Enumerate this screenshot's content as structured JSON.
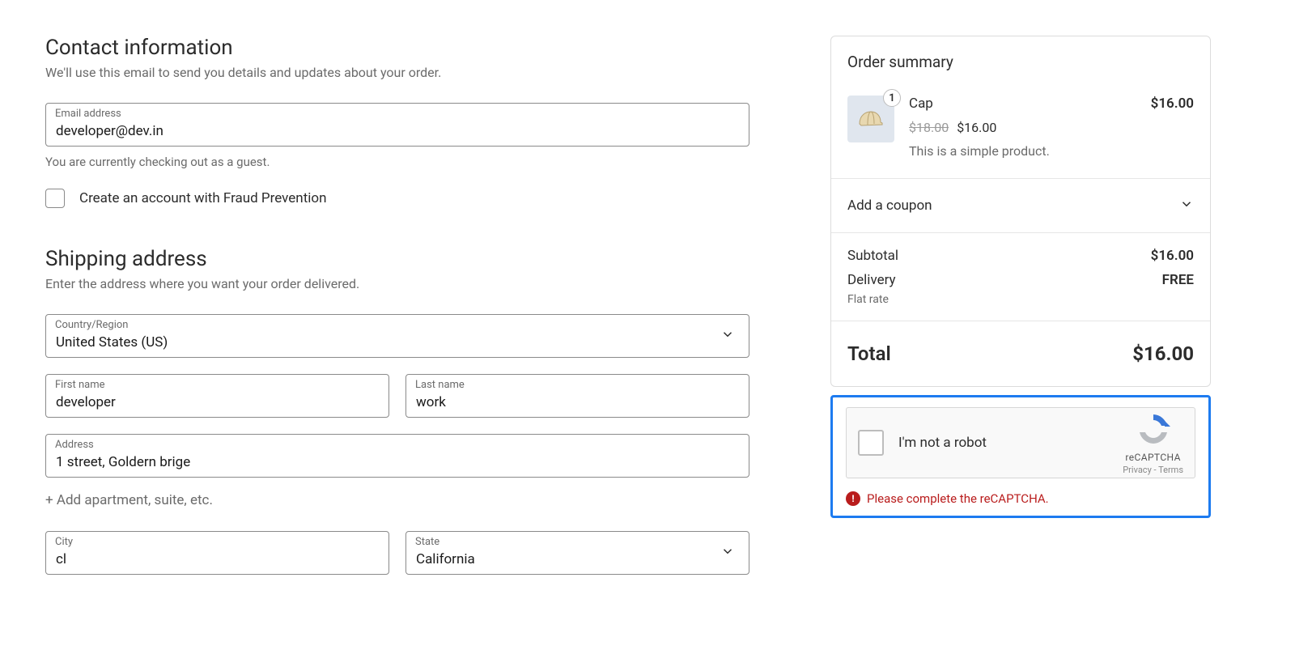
{
  "contact": {
    "title": "Contact information",
    "desc": "We'll use this email to send you details and updates about your order.",
    "email_label": "Email address",
    "email_value": "developer@dev.in",
    "guest_notice": "You are currently checking out as a guest.",
    "create_account_label": "Create an account with Fraud Prevention"
  },
  "shipping": {
    "title": "Shipping address",
    "desc": "Enter the address where you want your order delivered.",
    "country_label": "Country/Region",
    "country_value": "United States (US)",
    "first_name_label": "First name",
    "first_name_value": "developer",
    "last_name_label": "Last name",
    "last_name_value": "work",
    "address_label": "Address",
    "address_value": "1 street, Goldern brige",
    "add_apartment": "+ Add apartment, suite, etc.",
    "city_label": "City",
    "city_value": "cl",
    "state_label": "State",
    "state_value": "California"
  },
  "summary": {
    "title": "Order summary",
    "item": {
      "name": "Cap",
      "price": "$16.00",
      "qty": "1",
      "old_price": "$18.00",
      "new_price": "$16.00",
      "desc": "This is a simple product."
    },
    "coupon_label": "Add a coupon",
    "subtotal_label": "Subtotal",
    "subtotal_value": "$16.00",
    "delivery_label": "Delivery",
    "delivery_value": "FREE",
    "delivery_method": "Flat rate",
    "total_label": "Total",
    "total_value": "$16.00"
  },
  "recaptcha": {
    "not_robot": "I'm not a robot",
    "brand": "reCAPTCHA",
    "privacy": "Privacy",
    "terms": "Terms",
    "error": "Please complete the reCAPTCHA."
  }
}
